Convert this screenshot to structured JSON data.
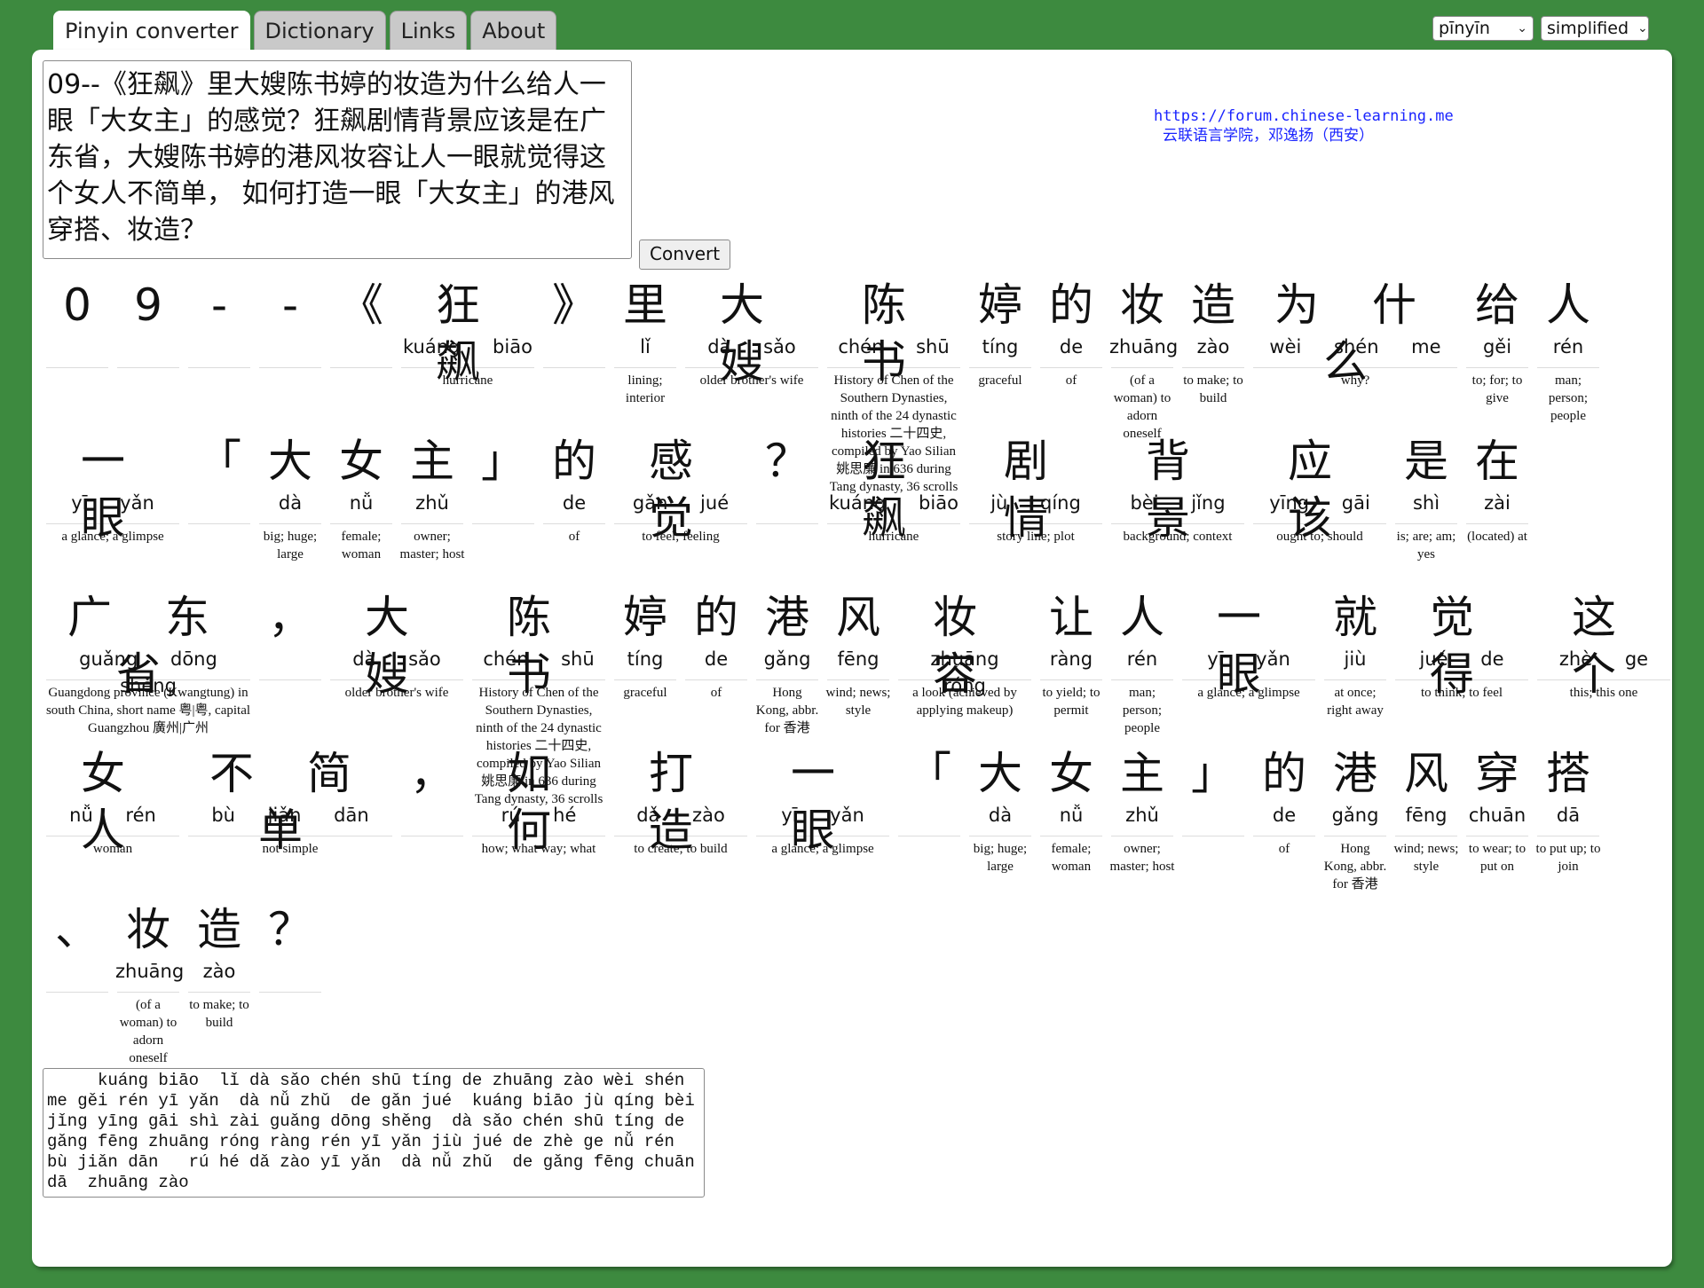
{
  "tabs": [
    {
      "label": "Pinyin converter",
      "active": true
    },
    {
      "label": "Dictionary",
      "active": false
    },
    {
      "label": "Links",
      "active": false
    },
    {
      "label": "About",
      "active": false
    }
  ],
  "selects": {
    "tone_style": "pīnyīn",
    "script": "simplified"
  },
  "input_text": "09--《狂飙》里大嫂陈书婷的妆造为什么给人一眼「大女主」的感觉？狂飙剧情背景应该是在广东省，大嫂陈书婷的港风妆容让人一眼就觉得这个女人不简单， 如何打造一眼「大女主」的港风穿搭、妆造？",
  "convert_label": "Convert",
  "credit": {
    "url": "https://forum.chinese-learning.me",
    "line2": "云联语言学院，邓逸扬（西安）"
  },
  "rows": [
    [
      {
        "han": "0",
        "py": "",
        "gloss": ""
      },
      {
        "han": "9",
        "py": "",
        "gloss": ""
      },
      {
        "han": "-",
        "py": "",
        "gloss": ""
      },
      {
        "han": "-",
        "py": "",
        "gloss": ""
      },
      {
        "han": "《",
        "py": "",
        "gloss": ""
      },
      {
        "han": "狂 飙",
        "py": "kuáng biāo",
        "gloss": "hurricane",
        "wide": true
      },
      {
        "han": "》",
        "py": "",
        "gloss": ""
      },
      {
        "han": "里",
        "py": "lǐ",
        "gloss": "lining; interior"
      },
      {
        "han": "大 嫂",
        "py": "dà sǎo",
        "gloss": "older brother's wife",
        "wide": true
      },
      {
        "han": "陈 书",
        "py": "chén shū",
        "gloss": "History of Chen of the Southern Dynasties, ninth of the 24 dynastic histories 二十四史, compiled by Yao Silian 姚思廉 in 636 during Tang dynasty, 36 scrolls",
        "wide": true
      },
      {
        "han": "婷",
        "py": "tíng",
        "gloss": "graceful"
      },
      {
        "han": "的",
        "py": "de",
        "gloss": "of"
      },
      {
        "han": "妆",
        "py": "zhuāng",
        "gloss": "(of a woman) to adorn oneself"
      },
      {
        "han": "造",
        "py": "zào",
        "gloss": "to make; to build"
      },
      {
        "han": "为 什 么",
        "py": "wèi shén me",
        "gloss": "why?",
        "wide": true
      },
      {
        "han": "给",
        "py": "gěi",
        "gloss": "to; for; to give"
      },
      {
        "han": "人",
        "py": "rén",
        "gloss": "man; person; people"
      }
    ],
    [
      {
        "han": "一 眼",
        "py": "yī yǎn",
        "gloss": "a glance; a glimpse",
        "wide": true
      },
      {
        "han": "「",
        "py": "",
        "gloss": ""
      },
      {
        "han": "大",
        "py": "dà",
        "gloss": "big; huge; large"
      },
      {
        "han": "女",
        "py": "nǚ",
        "gloss": "female; woman"
      },
      {
        "han": "主",
        "py": "zhǔ",
        "gloss": "owner; master; host"
      },
      {
        "han": "」",
        "py": "",
        "gloss": ""
      },
      {
        "han": "的",
        "py": "de",
        "gloss": "of"
      },
      {
        "han": "感 觉",
        "py": "gǎn jué",
        "gloss": "to feel; feeling",
        "wide": true
      },
      {
        "han": "？",
        "py": "",
        "gloss": ""
      },
      {
        "han": "狂 飙",
        "py": "kuáng biāo",
        "gloss": "hurricane",
        "wide": true
      },
      {
        "han": "剧 情",
        "py": "jù qíng",
        "gloss": "story line; plot",
        "wide": true
      },
      {
        "han": "背 景",
        "py": "bèi jǐng",
        "gloss": "background; context",
        "wide": true
      },
      {
        "han": "应 该",
        "py": "yīng gāi",
        "gloss": "ought to; should",
        "wide": true
      },
      {
        "han": "是",
        "py": "shì",
        "gloss": "is; are; am; yes"
      },
      {
        "han": "在",
        "py": "zài",
        "gloss": "(located) at"
      }
    ],
    [
      {
        "han": "广 东 省",
        "py": "guǎng dōng shěng",
        "gloss": "Guangdong province (Kwangtung) in south China, short name 粤|粤, capital Guangzhou 廣州|广州",
        "wide": true
      },
      {
        "han": "，",
        "py": "",
        "gloss": ""
      },
      {
        "han": "大 嫂",
        "py": "dà sǎo",
        "gloss": "older brother's wife",
        "wide": true
      },
      {
        "han": "陈 书",
        "py": "chén shū",
        "gloss": "History of Chen of the Southern Dynasties, ninth of the 24 dynastic histories 二十四史, compiled by Yao Silian 姚思廉 in 636 during Tang dynasty, 36 scrolls",
        "wide": true
      },
      {
        "han": "婷",
        "py": "tíng",
        "gloss": "graceful"
      },
      {
        "han": "的",
        "py": "de",
        "gloss": "of"
      },
      {
        "han": "港",
        "py": "gǎng",
        "gloss": "Hong Kong, abbr. for 香港"
      },
      {
        "han": "风",
        "py": "fēng",
        "gloss": "wind; news; style"
      },
      {
        "han": "妆 容",
        "py": "zhuāng róng",
        "gloss": "a look (achieved by applying makeup)",
        "wide": true
      },
      {
        "han": "让",
        "py": "ràng",
        "gloss": "to yield; to permit"
      },
      {
        "han": "人",
        "py": "rén",
        "gloss": "man; person; people"
      },
      {
        "han": "一 眼",
        "py": "yī yǎn",
        "gloss": "a glance; a glimpse",
        "wide": true
      },
      {
        "han": "就",
        "py": "jiù",
        "gloss": "at once; right away"
      },
      {
        "han": "觉 得",
        "py": "jué de",
        "gloss": "to think; to feel",
        "wide": true
      },
      {
        "han": "这 个",
        "py": "zhè ge",
        "gloss": "this; this one",
        "wide": true
      }
    ],
    [
      {
        "han": "女 人",
        "py": "nǚ rén",
        "gloss": "woman",
        "wide": true
      },
      {
        "han": "不 简 单",
        "py": "bù jiǎn dān",
        "gloss": "not simple",
        "wide": true
      },
      {
        "han": "，",
        "py": "",
        "gloss": ""
      },
      {
        "han": "如 何",
        "py": "rú hé",
        "gloss": "how; what way; what",
        "wide": true
      },
      {
        "han": "打 造",
        "py": "dǎ zào",
        "gloss": "to create; to build",
        "wide": true
      },
      {
        "han": "一 眼",
        "py": "yī yǎn",
        "gloss": "a glance; a glimpse",
        "wide": true
      },
      {
        "han": "「",
        "py": "",
        "gloss": ""
      },
      {
        "han": "大",
        "py": "dà",
        "gloss": "big; huge; large"
      },
      {
        "han": "女",
        "py": "nǚ",
        "gloss": "female; woman"
      },
      {
        "han": "主",
        "py": "zhǔ",
        "gloss": "owner; master; host"
      },
      {
        "han": "」",
        "py": "",
        "gloss": ""
      },
      {
        "han": "的",
        "py": "de",
        "gloss": "of"
      },
      {
        "han": "港",
        "py": "gǎng",
        "gloss": "Hong Kong, abbr. for 香港"
      },
      {
        "han": "风",
        "py": "fēng",
        "gloss": "wind; news; style"
      },
      {
        "han": "穿",
        "py": "chuān",
        "gloss": "to wear; to put on"
      },
      {
        "han": "搭",
        "py": "dā",
        "gloss": "to put up; to join"
      }
    ],
    [
      {
        "han": "、",
        "py": "",
        "gloss": ""
      },
      {
        "han": "妆",
        "py": "zhuāng",
        "gloss": "(of a woman) to adorn oneself"
      },
      {
        "han": "造",
        "py": "zào",
        "gloss": "to make; to build"
      },
      {
        "han": "？",
        "py": "",
        "gloss": ""
      }
    ]
  ],
  "output_text": "     kuáng biāo  lǐ dà sǎo chén shū tíng de zhuāng zào wèi shén me gěi rén yī yǎn  dà nǚ zhǔ  de gǎn jué  kuáng biāo jù qíng bèi jǐng yīng gāi shì zài guǎng dōng shěng  dà sǎo chén shū tíng de gǎng fēng zhuāng róng ràng rén yī yǎn jiù jué de zhè ge nǚ rén bù jiǎn dān   rú hé dǎ zào yī yǎn  dà nǚ zhǔ  de gǎng fēng chuān dā  zhuāng zào"
}
